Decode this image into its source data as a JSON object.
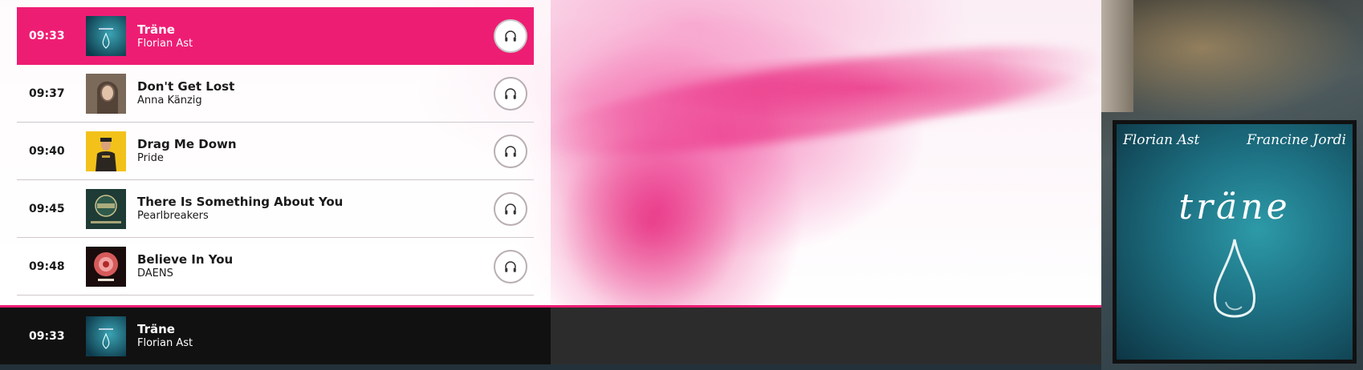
{
  "colors": {
    "accent": "#ee1d74",
    "now_playing_bg": "#111111",
    "bar_bg": "#2c2c2c"
  },
  "playlist": [
    {
      "time": "09:33",
      "title": "Träne",
      "artist": "Florian Ast",
      "cover": "trane-cover",
      "active": true
    },
    {
      "time": "09:37",
      "title": "Don't Get Lost",
      "artist": "Anna Känzig",
      "cover": "portrait-cover",
      "active": false
    },
    {
      "time": "09:40",
      "title": "Drag Me Down",
      "artist": "Pride",
      "cover": "soldier-cover",
      "active": false
    },
    {
      "time": "09:45",
      "title": "There Is Something About You",
      "artist": "Pearlbreakers",
      "cover": "pearl-sonic-cover",
      "active": false
    },
    {
      "time": "09:48",
      "title": "Believe In You",
      "artist": "DAENS",
      "cover": "red-flower-cover",
      "active": false
    }
  ],
  "listen_icon": "headphones-icon",
  "now_playing": {
    "time": "09:33",
    "title": "Träne",
    "artist": "Florian Ast"
  },
  "album_art": {
    "artist_left": "Florian Ast",
    "artist_right": "Francine Jordi",
    "title": "träne"
  }
}
